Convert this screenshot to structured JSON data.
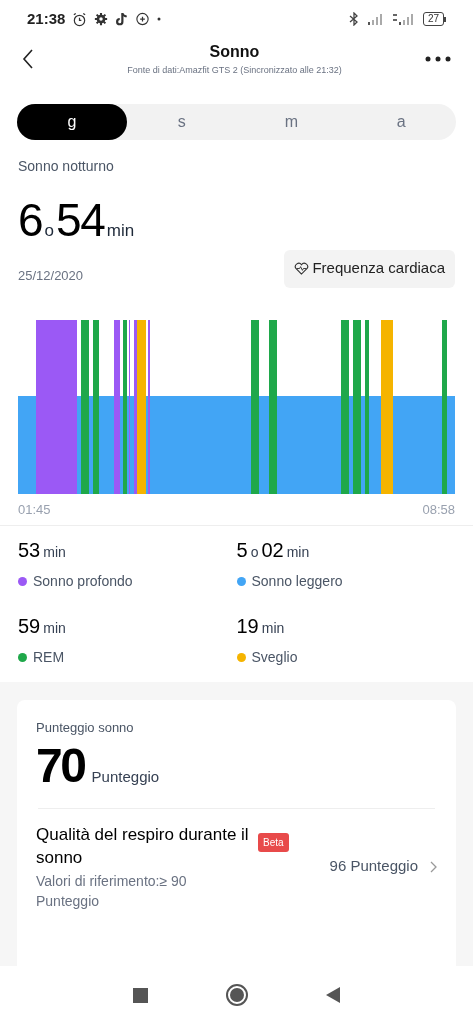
{
  "status_bar": {
    "time": "21:38",
    "battery": "27"
  },
  "header": {
    "title": "Sonno",
    "subtitle": "Fonte di dati:Amazfit GTS 2 (Sincronizzato alle 21:32)"
  },
  "tabs": [
    {
      "label": "g",
      "selected": true
    },
    {
      "label": "s",
      "selected": false
    },
    {
      "label": "m",
      "selected": false
    },
    {
      "label": "a",
      "selected": false
    }
  ],
  "summary": {
    "label": "Sonno notturno",
    "value": [
      {
        "text": "6",
        "kind": "number"
      },
      {
        "text": "o",
        "kind": "unit"
      },
      {
        "text": "54",
        "kind": "number"
      },
      {
        "text": "min",
        "kind": "unit"
      }
    ],
    "date": "25/12/2020",
    "heart_rate_button": "Frequenza cardiaca"
  },
  "chart": {
    "start": "01:45",
    "end": "08:58"
  },
  "stages": [
    {
      "value": [
        {
          "text": "53",
          "kind": "number"
        },
        {
          "text": "min",
          "kind": "unit"
        }
      ],
      "label": "Sonno profondo",
      "color": "#9b59f5"
    },
    {
      "value": [
        {
          "text": "5",
          "kind": "number"
        },
        {
          "text": "o",
          "kind": "unit"
        },
        {
          "text": "02",
          "kind": "number"
        },
        {
          "text": "min",
          "kind": "unit"
        }
      ],
      "label": "Sonno leggero",
      "color": "#42a5f5"
    },
    {
      "value": [
        {
          "text": "59",
          "kind": "number"
        },
        {
          "text": "min",
          "kind": "unit"
        }
      ],
      "label": "REM",
      "color": "#1fa84a"
    },
    {
      "value": [
        {
          "text": "19",
          "kind": "number"
        },
        {
          "text": "min",
          "kind": "unit"
        }
      ],
      "label": "Sveglio",
      "color": "#f5b400"
    }
  ],
  "score_card": {
    "label": "Punteggio sonno",
    "score": "70",
    "score_unit": "Punteggio",
    "breathing": {
      "title": "Qualità del respiro durante il sonno",
      "badge": "Beta",
      "reference": "Valori di riferimento:≥ 90 Punteggio",
      "value": "96 Punteggio"
    }
  }
}
